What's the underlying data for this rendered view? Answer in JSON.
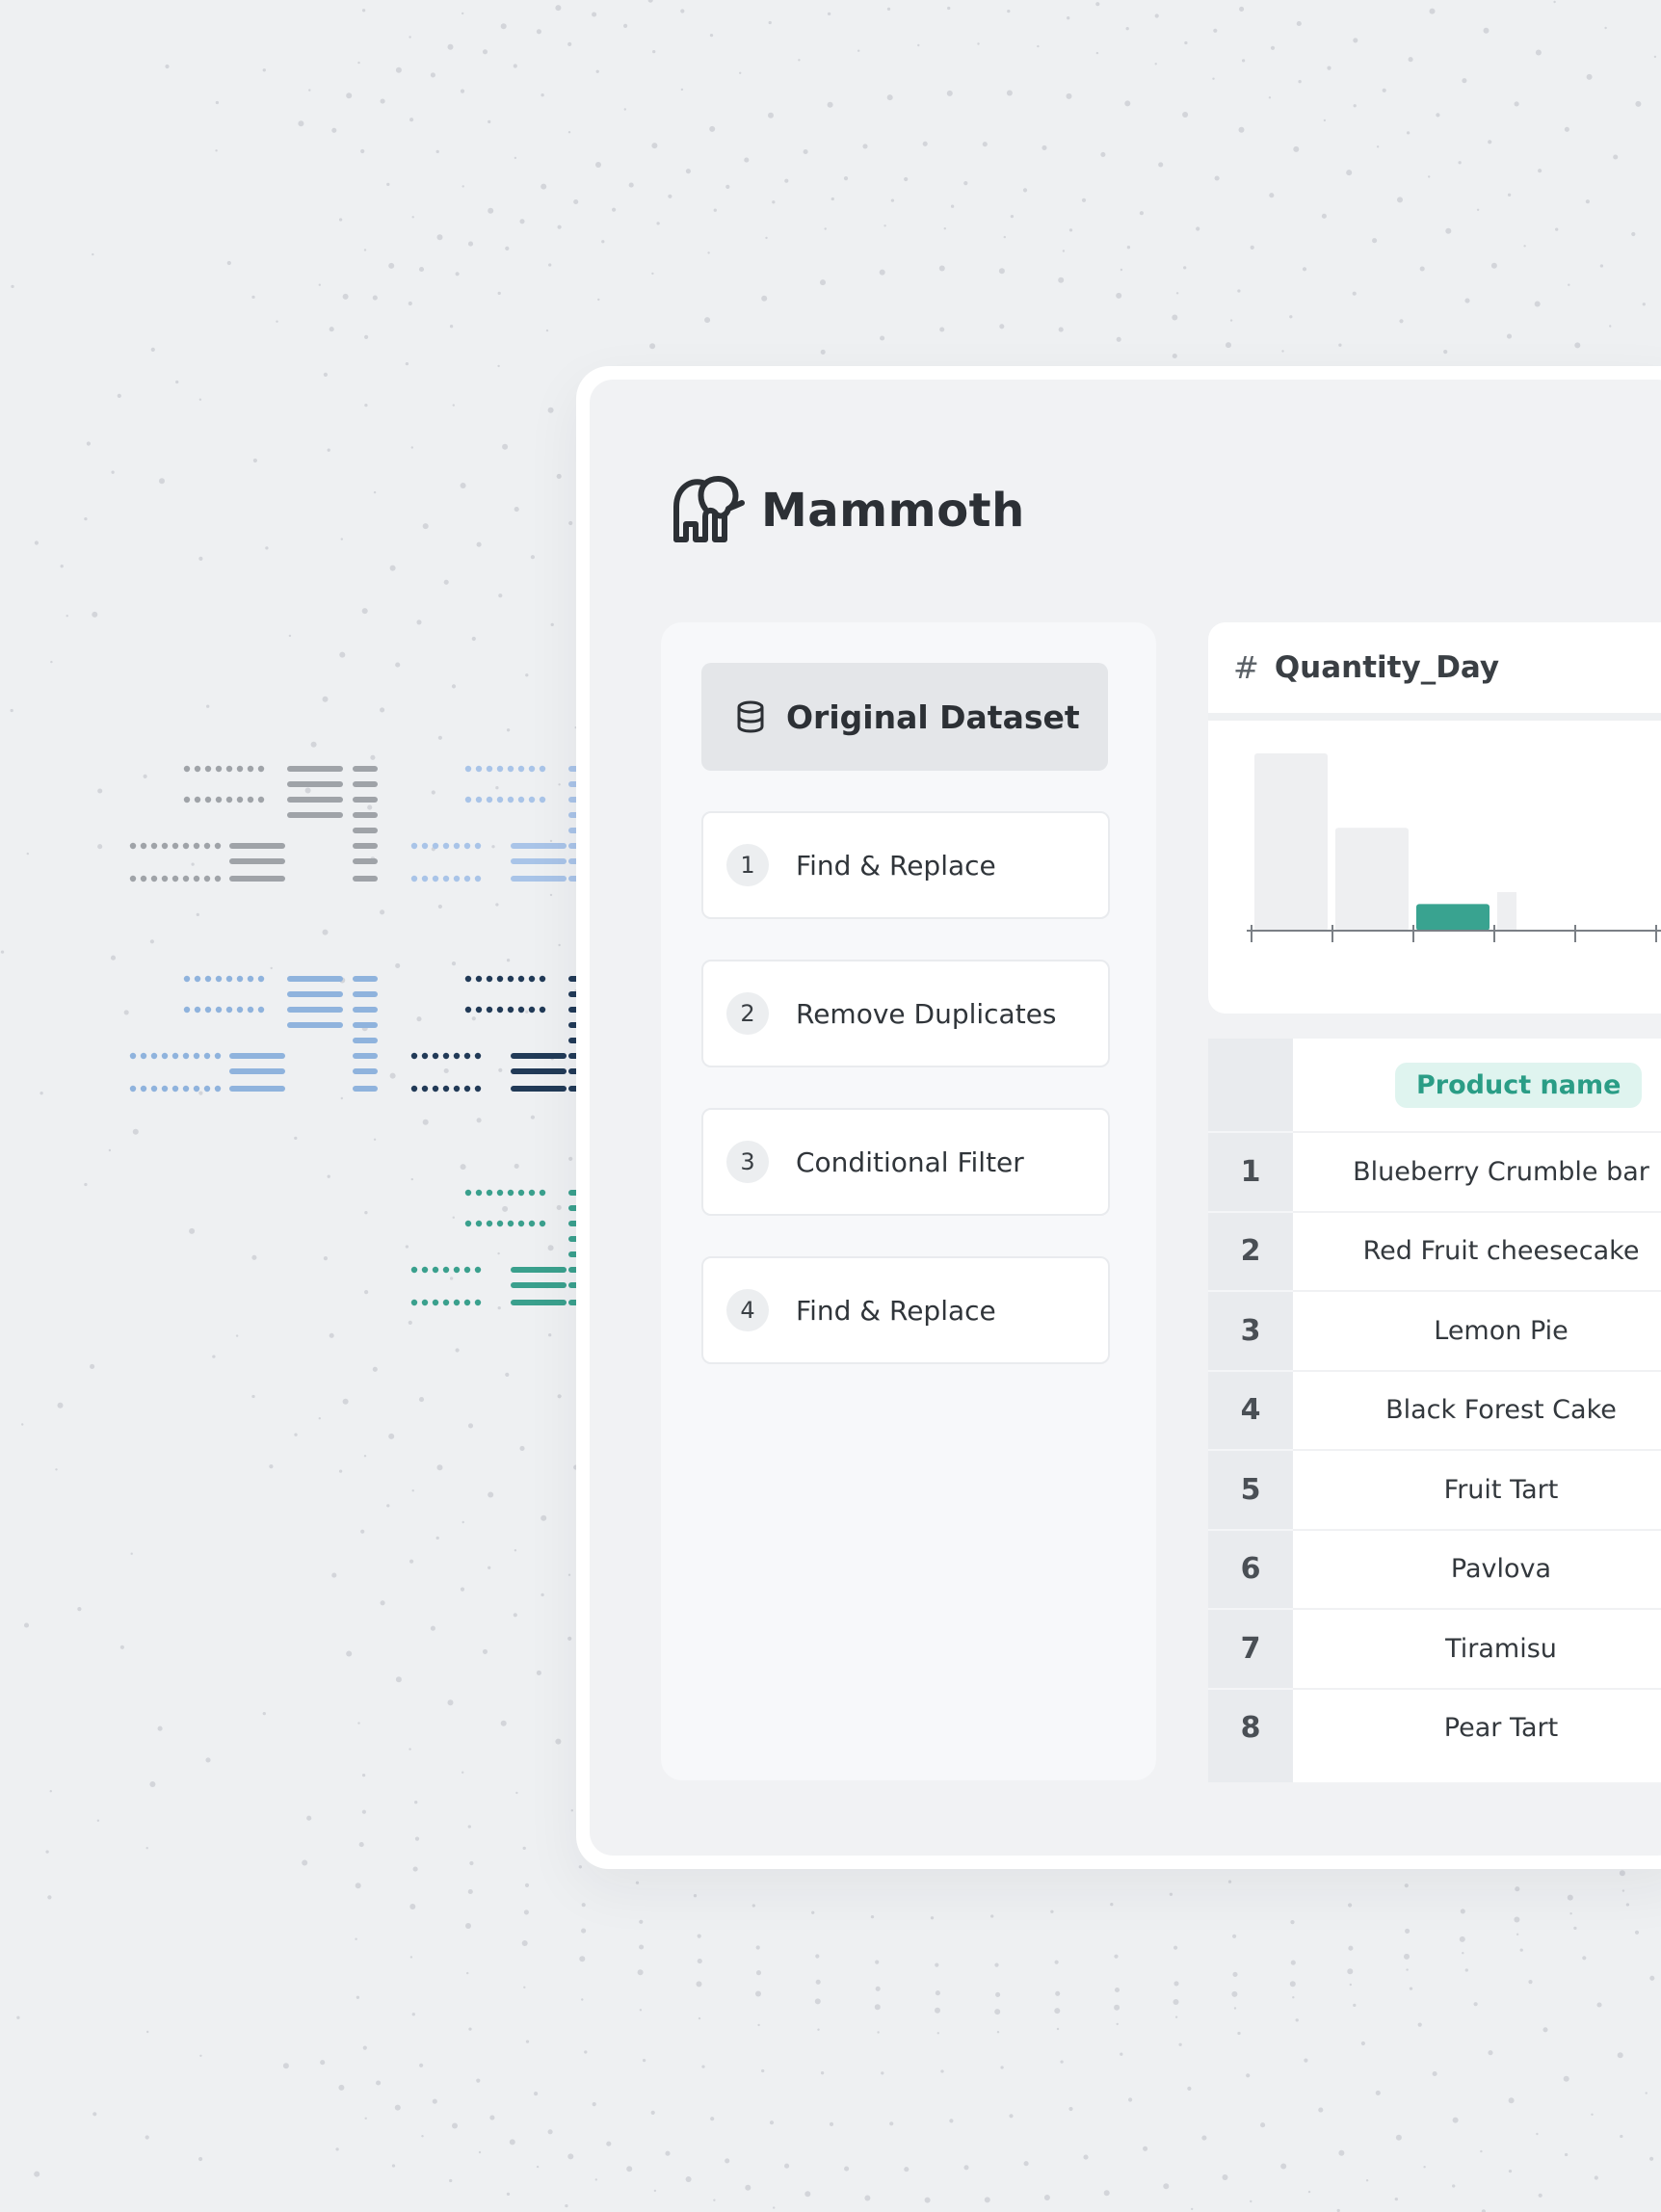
{
  "brand": {
    "name": "Mammoth",
    "logo_icon": "mammoth-logo-icon"
  },
  "steps_panel": {
    "dataset_button": {
      "label": "Original Dataset",
      "icon": "database-icon"
    },
    "steps": [
      {
        "number": "1",
        "label": "Find & Replace"
      },
      {
        "number": "2",
        "label": "Remove Duplicates"
      },
      {
        "number": "3",
        "label": "Conditional Filter"
      },
      {
        "number": "4",
        "label": "Find & Replace"
      }
    ]
  },
  "column_summary": {
    "type_symbol": "#",
    "column_name": "Quantity_Day"
  },
  "chart_data": {
    "type": "bar",
    "title": "",
    "xlabel": "",
    "ylabel": "",
    "values": [
      1.0,
      0.58,
      0.15
    ],
    "highlighted_index": 2,
    "colors": {
      "default": "#eeeff1",
      "highlight": "#39a390",
      "axis": "#7a7f85"
    }
  },
  "table": {
    "column_header": "Product name",
    "rows": [
      {
        "index": "1",
        "product": "Blueberry Crumble bar"
      },
      {
        "index": "2",
        "product": "Red Fruit cheesecake"
      },
      {
        "index": "3",
        "product": "Lemon Pie"
      },
      {
        "index": "4",
        "product": "Black Forest Cake"
      },
      {
        "index": "5",
        "product": "Fruit Tart"
      },
      {
        "index": "6",
        "product": "Pavlova"
      },
      {
        "index": "7",
        "product": "Tiramisu"
      },
      {
        "index": "8",
        "product": "Pear Tart"
      }
    ]
  },
  "colors": {
    "accent": "#2a9d86",
    "accent_bg": "#dff4ef",
    "page_bg": "#eef0f2"
  }
}
